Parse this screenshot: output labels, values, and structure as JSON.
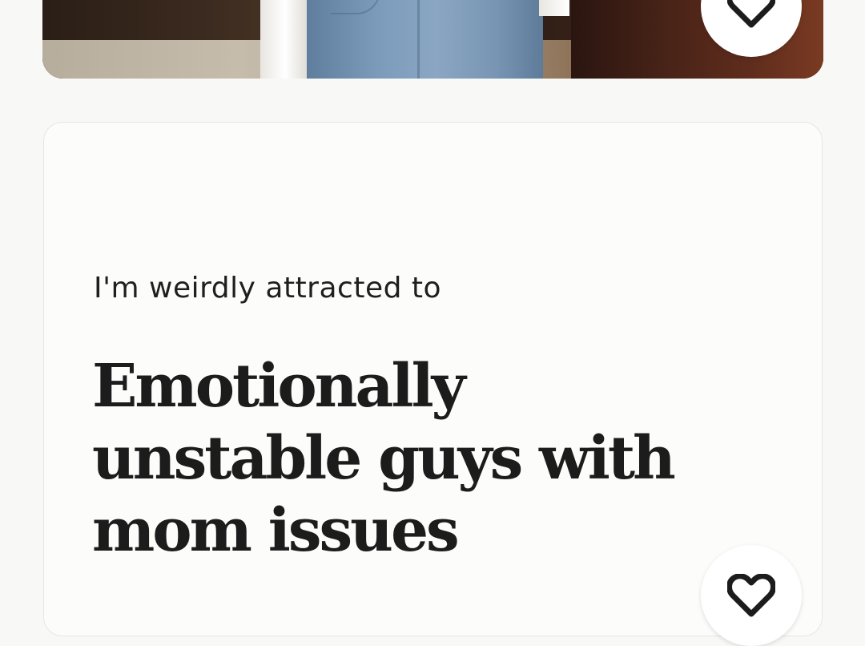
{
  "photo_card": {
    "image_description_name": "photo",
    "like_icon": "heart-icon"
  },
  "prompt_card": {
    "prompt": "I'm weirdly attracted to",
    "answer": "Emotionally unstable guys with mom issues",
    "like_icon": "heart-icon"
  },
  "colors": {
    "background": "#f8f8f6",
    "card": "#fcfcfa",
    "text": "#1c1c1c"
  }
}
